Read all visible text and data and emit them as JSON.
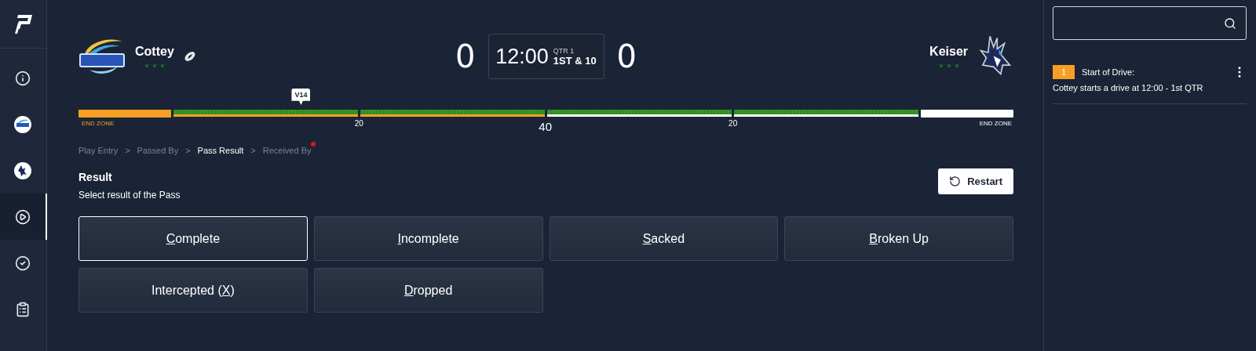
{
  "sidebar": {
    "items": [
      {
        "kind": "info",
        "selected": false
      },
      {
        "kind": "home-logo",
        "selected": false
      },
      {
        "kind": "away-logo",
        "selected": false
      },
      {
        "kind": "play",
        "selected": true
      },
      {
        "kind": "check",
        "selected": false
      },
      {
        "kind": "clipboard",
        "selected": false
      }
    ]
  },
  "scoreboard": {
    "home": {
      "name": "Cottey",
      "score": "0",
      "possession": true
    },
    "away": {
      "name": "Keiser",
      "score": "0",
      "possession": false
    },
    "clock": "12:00",
    "quarter": "QTR 1",
    "down": "1ST & 10"
  },
  "field": {
    "ball_marker": {
      "label": "V14",
      "level": 0.238
    },
    "segments": [
      {
        "kind": "endzone",
        "color": "#f5a024",
        "label": "END ZONE"
      },
      {
        "kind": "field",
        "color": "#f5a024",
        "yard": "20",
        "major": false
      },
      {
        "kind": "field",
        "color": "#f5a024",
        "yard": "40",
        "major": true
      },
      {
        "kind": "field",
        "color": "#ffffff",
        "yard": "20",
        "major": false
      },
      {
        "kind": "field",
        "color": "#ffffff"
      },
      {
        "kind": "endzone",
        "color": "#ffffff",
        "label": "END ZONE"
      }
    ]
  },
  "breadcrumbs": [
    {
      "label": "Play Entry",
      "selected": false,
      "alert": false
    },
    {
      "separator": ">",
      "label": "Passed By",
      "selected": false,
      "alert": false
    },
    {
      "separator": ">",
      "label": "Pass Result",
      "selected": true,
      "alert": false
    },
    {
      "separator": ">",
      "label": "Received By",
      "selected": false,
      "alert": true
    }
  ],
  "result": {
    "title": "Result",
    "subtitle": "Select result of the Pass",
    "restart": "Restart"
  },
  "options": [
    {
      "hotkey": "C",
      "after": "omplete",
      "selected": true
    },
    {
      "hotkey": "I",
      "after": "ncomplete",
      "selected": false
    },
    {
      "hotkey": "S",
      "after": "acked",
      "selected": false
    },
    {
      "hotkey": "B",
      "after": "roken Up",
      "selected": false
    },
    {
      "before": "Intercepted (",
      "hotkey": "X",
      "after": ")",
      "selected": false
    },
    {
      "hotkey": "D",
      "after": "ropped",
      "selected": false
    }
  ],
  "drive_log": [
    {
      "number": "1",
      "color": "#f5a024",
      "title": "Start of Drive:",
      "text": "Cottey starts a drive at 12:00 - 1st QTR"
    }
  ]
}
